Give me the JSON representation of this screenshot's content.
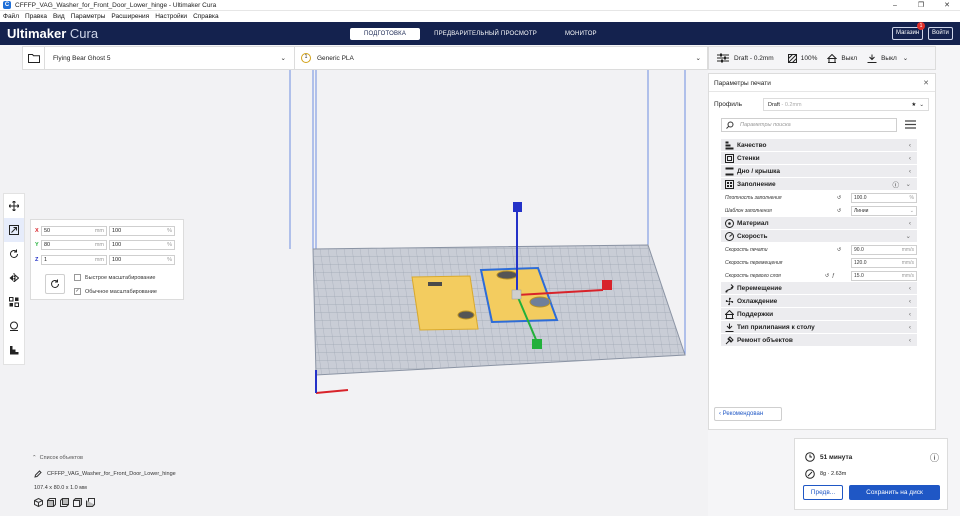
{
  "window": {
    "title": "CFFFP_VAG_Washer_for_Front_Door_Lower_hinge - Ultimaker Cura"
  },
  "menu": [
    "Файл",
    "Правка",
    "Вид",
    "Параметры",
    "Расширения",
    "Настройки",
    "Справка"
  ],
  "header": {
    "brand": "Ultimaker",
    "brand_suffix": "Cura",
    "stages": [
      "ПОДГОТОВКА",
      "ПРЕДВАРИТЕЛЬНЫЙ ПРОСМОТР",
      "МОНИТОР"
    ],
    "active_stage": "ПОДГОТОВКА",
    "marketplace_label": "Магазин",
    "marketplace_badge": "1",
    "signin_label": "Войти",
    "accent": "#14224e"
  },
  "toolbar": {
    "printer": "Flying Bear Ghost 5",
    "extruder_number": "1",
    "material": "Generic PLA",
    "profile_summary": "Draft - 0.2mm",
    "infill_summary": "100%",
    "support_summary": "Выкл",
    "adhesion_summary": "Выкл"
  },
  "scale": {
    "x_label": "X",
    "x_mm": "50",
    "x_pct": "100",
    "y_label": "Y",
    "y_mm": "80",
    "y_pct": "100",
    "z_label": "Z",
    "z_mm": "1",
    "z_pct": "100",
    "unit_mm": "mm",
    "unit_pct": "%",
    "snap_label": "Быстрое масштабирование",
    "uniform_label": "Обычное масштабирование",
    "uniform_checked": true
  },
  "objects": {
    "list_label": "Список объектов",
    "name": "CFFFP_VAG_Washer_for_Front_Door_Lower_hinge",
    "dimensions": "107.4 x 80.0 x 1.0 мм"
  },
  "print_settings": {
    "header": "Параметры печати",
    "profile_label": "Профиль",
    "profile_name": "Draft",
    "profile_sub": "- 0.2mm",
    "search_placeholder": "Параметры поиска",
    "categories": [
      {
        "label": "Качество",
        "icon": "quality-icon"
      },
      {
        "label": "Стенки",
        "icon": "walls-icon"
      },
      {
        "label": "Дно / крышка",
        "icon": "top-bottom-icon"
      },
      {
        "label": "Заполнение",
        "icon": "infill-icon",
        "expanded": true
      },
      {
        "label": "Материал",
        "icon": "material-icon"
      },
      {
        "label": "Скорость",
        "icon": "speed-icon",
        "expanded": true
      },
      {
        "label": "Перемещение",
        "icon": "travel-icon"
      },
      {
        "label": "Охлаждение",
        "icon": "cooling-icon"
      },
      {
        "label": "Поддержки",
        "icon": "support-icon"
      },
      {
        "label": "Тип прилипания к столу",
        "icon": "adhesion-icon"
      },
      {
        "label": "Ремонт объектов",
        "icon": "mesh-fix-icon"
      }
    ],
    "infill_settings": [
      {
        "label": "Плотность заполнения",
        "value": "100.0",
        "unit": "%"
      },
      {
        "label": "Шаблон заполнения",
        "value": "Линии",
        "unit": ""
      }
    ],
    "speed_settings": [
      {
        "label": "Скорость печати",
        "value": "90.0",
        "unit": "mm/s"
      },
      {
        "label": "Скорость перемещения",
        "value": "120.0",
        "unit": "mm/s"
      },
      {
        "label": "Скорость первого слоя",
        "value": "15.0",
        "unit": "mm/s"
      }
    ],
    "recommended_label": "Рекомендован"
  },
  "output": {
    "time": "51 минута",
    "material_usage": "8g · 2.63m",
    "preview_label": "Предв...",
    "save_label": "Сохранить на диск"
  }
}
